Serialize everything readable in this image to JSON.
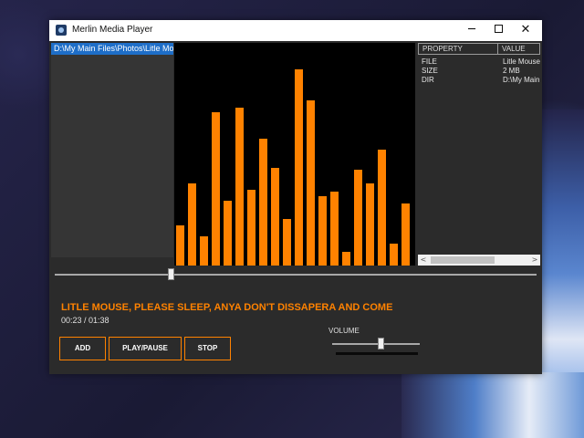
{
  "window": {
    "title": "Merlin Media Player",
    "minimize_glyph": "─",
    "close_glyph": "✕"
  },
  "playlist": {
    "items": [
      "D:\\My Main Files\\Photos\\Litle Mouse"
    ],
    "selected_index": 0
  },
  "visualizer": {
    "color": "#ff8200",
    "levels": [
      0.18,
      0.37,
      0.13,
      0.69,
      0.29,
      0.71,
      0.34,
      0.57,
      0.44,
      0.21,
      0.88,
      0.74,
      0.31,
      0.33,
      0.06,
      0.43,
      0.37,
      0.52,
      0.1,
      0.28
    ]
  },
  "properties": {
    "columns": [
      "PROPERTY",
      "VALUE"
    ],
    "rows": [
      {
        "key": "FILE",
        "value": "Litle Mouse"
      },
      {
        "key": "SIZE",
        "value": "2 MB"
      },
      {
        "key": "DIR",
        "value": "D:\\My Main"
      }
    ],
    "scroll_left_glyph": "<",
    "scroll_right_glyph": ">"
  },
  "seek": {
    "position_fraction": 0.24
  },
  "now_playing": {
    "title": "LITLE MOUSE, PLEASE SLEEP, ANYA DON'T DISSAPERA AND COME",
    "time": "00:23 / 01:38"
  },
  "controls": {
    "add_label": "ADD",
    "play_pause_label": "PLAY/PAUSE",
    "stop_label": "STOP"
  },
  "volume": {
    "label": "VOLUME",
    "level_fraction": 0.55
  },
  "colors": {
    "accent": "#ff8200",
    "selection": "#1e6ec8",
    "window_bg": "#2b2b2b"
  }
}
